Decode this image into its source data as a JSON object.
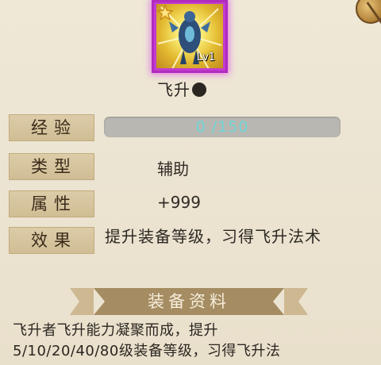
{
  "item": {
    "level": "Lv1",
    "name": "飞升"
  },
  "stats": {
    "exp_label": "经验",
    "exp_value": "0 /150",
    "exp_progress": 0,
    "type_label": "类型",
    "type_value": "辅助",
    "attr_label": "属性",
    "attr_value": "+999",
    "effect_label": "效果",
    "effect_value": "提升装备等级，习得飞升法术"
  },
  "section": {
    "title": "装备资料"
  },
  "description": "飞升者飞升能力凝聚而成，提升\n5/10/20/40/80级装备等级，习得飞升法"
}
